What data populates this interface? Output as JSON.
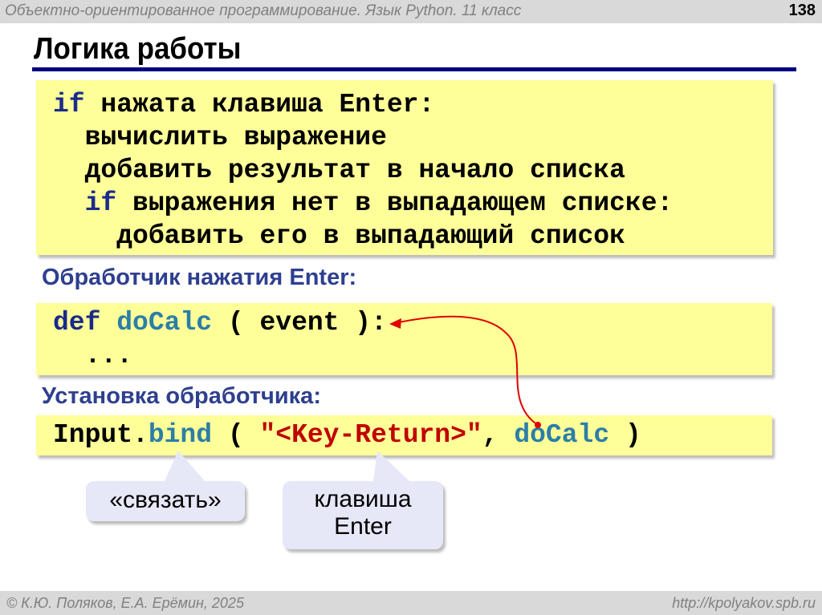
{
  "header": {
    "course": "Объектно-ориентированное программирование. Язык Python. 11 класс",
    "page": "138"
  },
  "title": "Логика работы",
  "pseudo": {
    "l1_kw": "if",
    "l1": " нажата клавиша Enter:",
    "l2": "  вычислить выражение",
    "l3": "  добавить результат в начало списка",
    "l4_pre": "  ",
    "l4_kw": "if",
    "l4": " выражения нет в выпадающем списке:",
    "l5": "    добавить его в выпадающий список"
  },
  "handler_heading": "Обработчик нажатия Enter:",
  "handler": {
    "kw": "def",
    "fn": " doCalc",
    "rest": " ( event ):",
    "l2": "  ..."
  },
  "bind_heading": "Установка обработчика:",
  "bind": {
    "obj": "Input.",
    "fn": "bind",
    "p1": " ( ",
    "str": "\"<Key-Return>\"",
    "p2": ", ",
    "arg": "doCalc",
    "p3": " )"
  },
  "callouts": {
    "bind": "«связать»",
    "key_l1": "клавиша",
    "key_l2": "Enter"
  },
  "footer": {
    "authors": "© К.Ю. Поляков, Е.А. Ерёмин, 2025",
    "url": "http://kpolyakov.spb.ru"
  }
}
